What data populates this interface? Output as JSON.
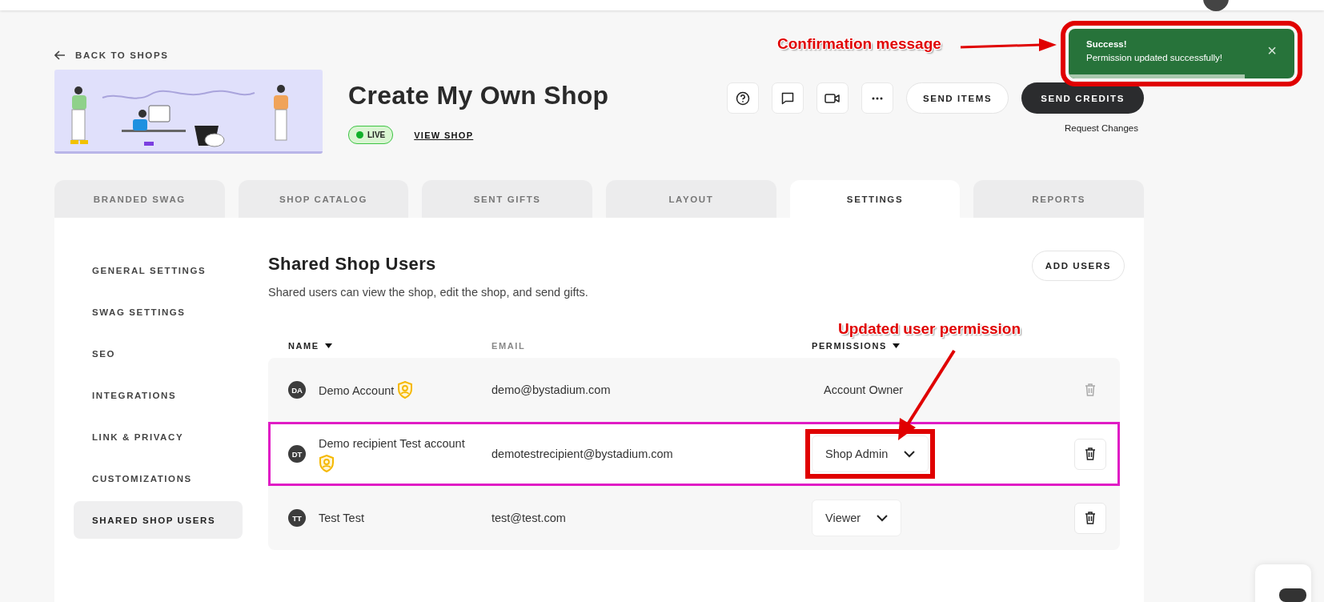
{
  "back_link": "BACK TO SHOPS",
  "shop": {
    "title": "Create My Own Shop",
    "status": {
      "label": "LIVE",
      "live": true
    },
    "view_link": "VIEW SHOP"
  },
  "actions": {
    "buttons": [
      {
        "label": "SEND ITEMS",
        "kind": "outline"
      },
      {
        "label": "SEND CREDITS",
        "kind": "primary"
      }
    ],
    "request_link": "Request Changes"
  },
  "toast": {
    "title": "Success!",
    "message": "Permission updated successfully!",
    "close": "×",
    "level": 0.78,
    "outlined": true
  },
  "tabs": [
    {
      "label": "BRANDED SWAG",
      "selected": false
    },
    {
      "label": "SHOP CATALOG",
      "selected": false
    },
    {
      "label": "SENT GIFTS",
      "selected": false
    },
    {
      "label": "LAYOUT",
      "selected": false
    },
    {
      "label": "SETTINGS",
      "selected": true
    },
    {
      "label": "REPORTS",
      "selected": false
    }
  ],
  "sidebar": {
    "items": [
      {
        "label": "GENERAL SETTINGS",
        "selected": false
      },
      {
        "label": "SWAG SETTINGS",
        "selected": false
      },
      {
        "label": "SEO",
        "selected": false
      },
      {
        "label": "INTEGRATIONS",
        "selected": false
      },
      {
        "label": "LINK & PRIVACY",
        "selected": false
      },
      {
        "label": "CUSTOMIZATIONS",
        "selected": false
      },
      {
        "label": "SHARED SHOP USERS",
        "selected": true
      }
    ]
  },
  "section": {
    "title": "Shared Shop Users",
    "description": "Shared users can view the shop, edit the shop, and send gifts.",
    "add_button": "ADD USERS"
  },
  "table": {
    "columns": [
      {
        "label": "NAME",
        "sortable": true
      },
      {
        "label": "EMAIL",
        "sortable": false
      },
      {
        "label": "PERMISSIONS",
        "sortable": true
      }
    ],
    "rows": [
      {
        "initials": "DA",
        "name": "Demo Account",
        "admin": true,
        "email": "demo@bystadium.com",
        "permission": {
          "kind": "text",
          "value": "Account Owner"
        },
        "delete_disabled": true,
        "outlined": false
      },
      {
        "initials": "DT",
        "name": "Demo recipient Test account",
        "admin": true,
        "email": "demotestrecipient@bystadium.com",
        "permission": {
          "kind": "dropdown",
          "value": "Shop Admin",
          "outlined": true
        },
        "delete_disabled": false,
        "outlined": true
      },
      {
        "initials": "TT",
        "name": "Test Test",
        "admin": false,
        "email": "test@test.com",
        "permission": {
          "kind": "dropdown",
          "value": "Viewer",
          "outlined": false
        },
        "delete_disabled": false,
        "outlined": false
      }
    ]
  },
  "annotations": [
    {
      "text": "Confirmation message"
    },
    {
      "text": "Updated user permission"
    }
  ]
}
